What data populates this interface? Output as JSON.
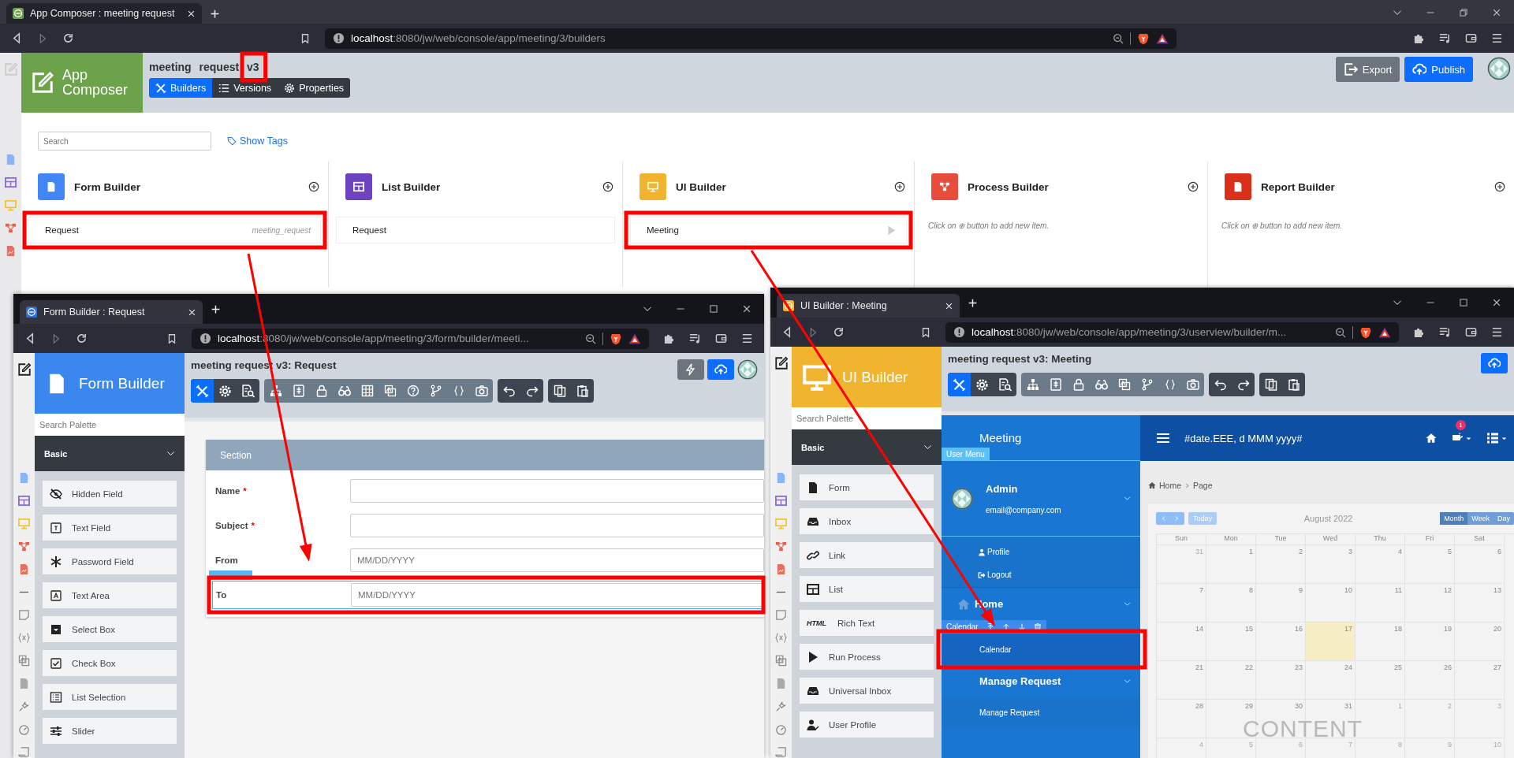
{
  "browser": {
    "kind": "composer",
    "tab_title": "App Composer : meeting request",
    "url": "**localhost**:8080/jw/web/console/app/meeting/3/builders"
  },
  "app": {
    "logo": "App Composer",
    "app_name": "meeting request v3",
    "nav": [
      {
        "label": "Builders",
        "kind": "builders",
        "selected": true
      },
      {
        "label": "Versions",
        "kind": "versions",
        "selected": false
      },
      {
        "label": "Properties",
        "kind": "properties",
        "selected": false
      }
    ],
    "actions": [
      {
        "label": "Export",
        "kind": "export"
      },
      {
        "label": "Publish",
        "kind": "publish"
      }
    ]
  },
  "search": {
    "placeholder": "Search"
  },
  "show_tags": "Show Tags",
  "builders": [
    {
      "title": "Form Builder",
      "kind": "form",
      "color": "#4285f4",
      "items": [
        {
          "label": "Request",
          "id_text": "meeting_request",
          "kind": "plain"
        }
      ]
    },
    {
      "title": "List Builder",
      "kind": "list",
      "color": "#6f42c1",
      "items": [
        {
          "label": "Request",
          "kind": "plain"
        }
      ]
    },
    {
      "title": "UI Builder",
      "kind": "ui",
      "color": "#f1b42f",
      "items": [
        {
          "label": "Meeting",
          "kind": "launch"
        }
      ]
    },
    {
      "title": "Process Builder",
      "kind": "process",
      "color": "#e74c3c",
      "hint": "Click on ⊕ button to add new item."
    },
    {
      "title": "Report Builder",
      "kind": "report",
      "color": "#d9301c",
      "hint": "Click on ⊕ button to add new item."
    }
  ],
  "form_window": {
    "browser": {
      "kind": "form",
      "tab_title": "Form Builder : Request",
      "url": "**localhost**:8080/jw/web/console/app/meeting/3/form/builder/meeti..."
    },
    "brand": "Form Builder",
    "title": "meeting request v3: Request",
    "tool_modes": [
      {
        "kind": "design",
        "selected": true
      },
      {
        "kind": "properties",
        "selected": false
      },
      {
        "kind": "preview",
        "selected": false
      }
    ],
    "palette_search": {
      "placeholder": "Search Palette"
    },
    "category": "Basic",
    "palette": [
      {
        "label": "Hidden Field",
        "kind": "hidden"
      },
      {
        "label": "Text Field",
        "kind": "text"
      },
      {
        "label": "Password Field",
        "kind": "password"
      },
      {
        "label": "Text Area",
        "kind": "textarea"
      },
      {
        "label": "Select Box",
        "kind": "select"
      },
      {
        "label": "Check Box",
        "kind": "checkbox"
      },
      {
        "label": "List Selection",
        "kind": "listsel"
      },
      {
        "label": "Slider",
        "kind": "slider"
      }
    ],
    "section": "Section",
    "required_mark": "*",
    "fields": [
      {
        "label": "Name",
        "required": true,
        "selected": false
      },
      {
        "label": "Subject",
        "required": true,
        "selected": false
      },
      {
        "label": "From",
        "required": false,
        "placeholder": "MM/DD/YYYY",
        "selected": false
      },
      {
        "label": "To",
        "required": false,
        "placeholder": "MM/DD/YYYY",
        "selected": true
      }
    ]
  },
  "ui_window": {
    "browser": {
      "kind": "ui",
      "tab_title": "UI Builder : Meeting",
      "url": "**localhost**:8080/jw/web/console/app/meeting/3/userview/builder/m..."
    },
    "brand": "UI Builder",
    "title": "meeting request v3: Meeting",
    "tool_modes": [
      {
        "kind": "design",
        "selected": true
      },
      {
        "kind": "properties",
        "selected": false
      },
      {
        "kind": "preview",
        "selected": false
      }
    ],
    "palette_search": {
      "placeholder": "Search Palette"
    },
    "category": "Basic",
    "palette": [
      {
        "label": "Form",
        "kind": "form"
      },
      {
        "label": "Inbox",
        "kind": "inbox"
      },
      {
        "label": "Link",
        "kind": "link"
      },
      {
        "label": "List",
        "kind": "list"
      },
      {
        "label": "Rich Text",
        "kind": "html",
        "icon_text": "HTML"
      },
      {
        "label": "Run Process",
        "kind": "run"
      },
      {
        "label": "Universal Inbox",
        "kind": "inbox"
      },
      {
        "label": "User Profile",
        "kind": "profile"
      }
    ],
    "userview": {
      "name": "Meeting",
      "menu_tag": "User Menu",
      "user": "Admin",
      "email": "email@company.com",
      "user_links": [
        {
          "label": "Profile",
          "kind": "profile"
        },
        {
          "label": "Logout",
          "kind": "logout"
        }
      ],
      "categories": [
        {
          "label": "Home",
          "kind": "home",
          "items": [
            {
              "label": "Calendar",
              "selected": true,
              "tag": "Calendar"
            }
          ]
        },
        {
          "label": "Manage Request",
          "kind": "plain",
          "items": [
            {
              "label": "Manage Request",
              "selected": false
            }
          ]
        }
      ],
      "header": "#date.EEE, d MMM yyyy#",
      "badge": "1",
      "breadcrumb": [
        "Home",
        "Page"
      ],
      "calendar": {
        "title": "August 2022",
        "today_button": "Today",
        "views": [
          {
            "label": "Month",
            "selected": true
          },
          {
            "label": "Week",
            "selected": false
          },
          {
            "label": "Day",
            "selected": false
          }
        ],
        "weekdays": [
          "Sun",
          "Mon",
          "Tue",
          "Wed",
          "Thu",
          "Fri",
          "Sat"
        ],
        "weeks": [
          [
            {
              "day": "31",
              "other_month": true,
              "today": false
            },
            {
              "day": "1",
              "other_month": false,
              "today": false
            },
            {
              "day": "2",
              "other_month": false,
              "today": false
            },
            {
              "day": "3",
              "other_month": false,
              "today": false
            },
            {
              "day": "4",
              "other_month": false,
              "today": false
            },
            {
              "day": "5",
              "other_month": false,
              "today": false
            },
            {
              "day": "6",
              "other_month": false,
              "today": false
            }
          ],
          [
            {
              "day": "7",
              "other_month": false,
              "today": false
            },
            {
              "day": "8",
              "other_month": false,
              "today": false
            },
            {
              "day": "9",
              "other_month": false,
              "today": false
            },
            {
              "day": "10",
              "other_month": false,
              "today": false
            },
            {
              "day": "11",
              "other_month": false,
              "today": false
            },
            {
              "day": "12",
              "other_month": false,
              "today": false
            },
            {
              "day": "13",
              "other_month": false,
              "today": false
            }
          ],
          [
            {
              "day": "14",
              "other_month": false,
              "today": false
            },
            {
              "day": "15",
              "other_month": false,
              "today": false
            },
            {
              "day": "16",
              "other_month": false,
              "today": false
            },
            {
              "day": "17",
              "other_month": false,
              "today": true
            },
            {
              "day": "18",
              "other_month": false,
              "today": false
            },
            {
              "day": "19",
              "other_month": false,
              "today": false
            },
            {
              "day": "20",
              "other_month": false,
              "today": false
            }
          ],
          [
            {
              "day": "21",
              "other_month": false,
              "today": false
            },
            {
              "day": "22",
              "other_month": false,
              "today": false
            },
            {
              "day": "23",
              "other_month": false,
              "today": false
            },
            {
              "day": "24",
              "other_month": false,
              "today": false
            },
            {
              "day": "25",
              "other_month": false,
              "today": false
            },
            {
              "day": "26",
              "other_month": false,
              "today": false
            },
            {
              "day": "27",
              "other_month": false,
              "today": false
            }
          ],
          [
            {
              "day": "28",
              "other_month": false,
              "today": false
            },
            {
              "day": "29",
              "other_month": false,
              "today": false
            },
            {
              "day": "30",
              "other_month": false,
              "today": false
            },
            {
              "day": "31",
              "other_month": false,
              "today": false
            },
            {
              "day": "1",
              "other_month": true,
              "today": false
            },
            {
              "day": "2",
              "other_month": true,
              "today": false
            },
            {
              "day": "3",
              "other_month": true,
              "today": false
            }
          ],
          [
            {
              "day": "4",
              "other_month": true,
              "today": false
            },
            {
              "day": "5",
              "other_month": true,
              "today": false
            },
            {
              "day": "6",
              "other_month": true,
              "today": false
            },
            {
              "day": "7",
              "other_month": true,
              "today": false
            },
            {
              "day": "8",
              "other_month": true,
              "today": false
            },
            {
              "day": "9",
              "other_month": true,
              "today": false
            },
            {
              "day": "10",
              "other_month": true,
              "today": false
            }
          ]
        ]
      },
      "content_label": "CONTENT"
    }
  }
}
